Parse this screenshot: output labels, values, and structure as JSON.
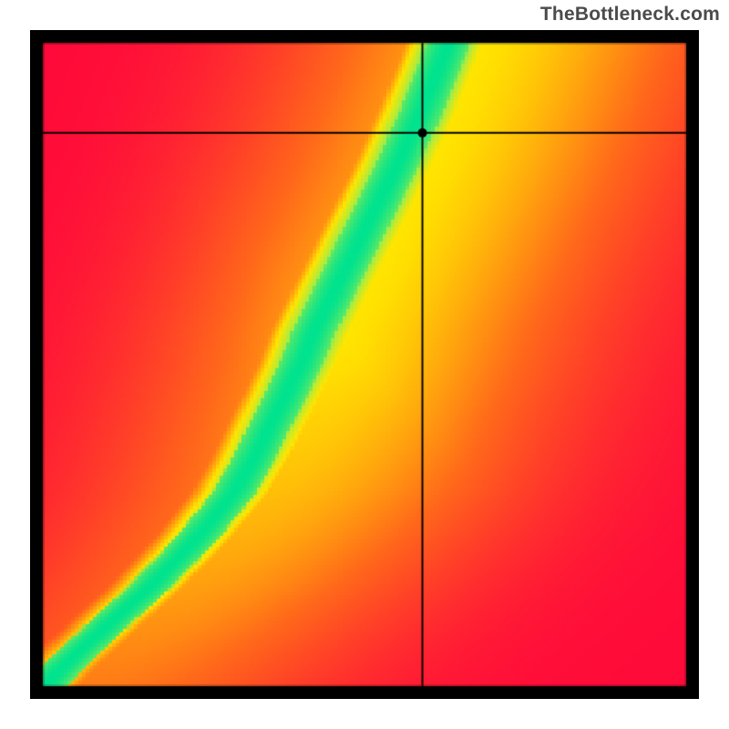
{
  "attribution": "TheBottleneck.com",
  "chart_data": {
    "type": "heatmap",
    "title": "",
    "xlabel": "",
    "ylabel": "",
    "grid": false,
    "xlim": [
      0,
      1
    ],
    "ylim": [
      0,
      1
    ],
    "colormap": {
      "note": "value 0 = red (#ff0030), 0.5 = yellow (#ffeb00), 1 = green (#00e38f)  (approximate RdYlGn-like)",
      "stops": [
        {
          "t": 0.0,
          "hex": "#ff0a3a"
        },
        {
          "t": 0.25,
          "hex": "#ff6a1a"
        },
        {
          "t": 0.5,
          "hex": "#ffe600"
        },
        {
          "t": 0.75,
          "hex": "#9eed4a"
        },
        {
          "t": 1.0,
          "hex": "#00e38f"
        }
      ]
    },
    "optimum_curve": {
      "note": "x as a function of y defining the green ridge; value = 1 along this curve and falls off with |x - f(y)|",
      "points": [
        {
          "y": 0.0,
          "x": 0.0
        },
        {
          "y": 0.05,
          "x": 0.05
        },
        {
          "y": 0.1,
          "x": 0.105
        },
        {
          "y": 0.15,
          "x": 0.16
        },
        {
          "y": 0.2,
          "x": 0.21
        },
        {
          "y": 0.25,
          "x": 0.255
        },
        {
          "y": 0.3,
          "x": 0.295
        },
        {
          "y": 0.35,
          "x": 0.325
        },
        {
          "y": 0.4,
          "x": 0.35
        },
        {
          "y": 0.45,
          "x": 0.375
        },
        {
          "y": 0.5,
          "x": 0.4
        },
        {
          "y": 0.55,
          "x": 0.42
        },
        {
          "y": 0.6,
          "x": 0.445
        },
        {
          "y": 0.65,
          "x": 0.47
        },
        {
          "y": 0.7,
          "x": 0.495
        },
        {
          "y": 0.75,
          "x": 0.52
        },
        {
          "y": 0.8,
          "x": 0.545
        },
        {
          "y": 0.85,
          "x": 0.568
        },
        {
          "y": 0.9,
          "x": 0.59
        },
        {
          "y": 0.95,
          "x": 0.61
        },
        {
          "y": 1.0,
          "x": 0.63
        }
      ]
    },
    "falloff_sigma": 0.045,
    "crosshair": {
      "x": 0.59,
      "y": 0.86
    },
    "marker": {
      "x": 0.59,
      "y": 0.86,
      "radius_px": 5
    }
  }
}
